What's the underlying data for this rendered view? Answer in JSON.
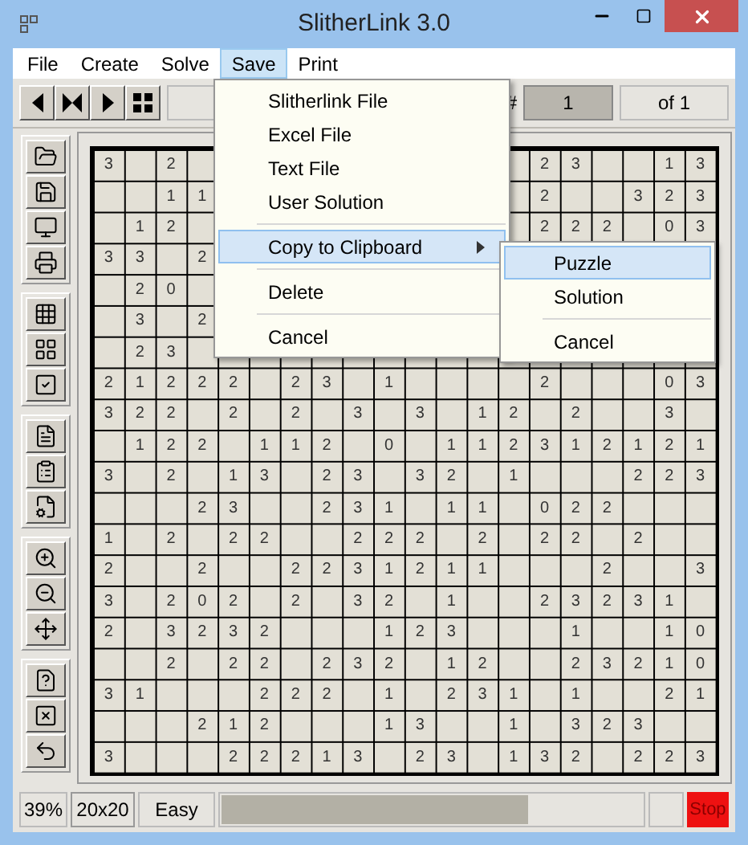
{
  "window": {
    "title": "SlitherLink 3.0"
  },
  "menu_bar": [
    {
      "label": "File",
      "selected": false
    },
    {
      "label": "Create",
      "selected": false
    },
    {
      "label": "Solve",
      "selected": false
    },
    {
      "label": "Save",
      "selected": true
    },
    {
      "label": "Print",
      "selected": false
    }
  ],
  "toolbar": {
    "puzzle_number_label": "#",
    "puzzle_number": "1",
    "puzzle_count": "of 1"
  },
  "grid": {
    "rows": [
      [
        "3",
        "",
        "2",
        "",
        "",
        "",
        "",
        "",
        "",
        "",
        "",
        "",
        "",
        "",
        "2",
        "3",
        "",
        "",
        "1",
        "3"
      ],
      [
        "",
        "",
        "1",
        "1",
        "",
        "",
        "",
        "",
        "",
        "",
        "",
        "",
        "",
        "",
        "2",
        "",
        "",
        "3",
        "2",
        "3"
      ],
      [
        "",
        "1",
        "2",
        "",
        "",
        "",
        "",
        "",
        "",
        "",
        "",
        "",
        "",
        "",
        "2",
        "2",
        "2",
        "",
        "0",
        "3"
      ],
      [
        "3",
        "3",
        "",
        "2",
        "",
        "",
        "",
        "",
        "",
        "",
        "",
        "",
        "",
        "",
        "",
        "",
        "",
        "",
        "",
        ""
      ],
      [
        "",
        "2",
        "0",
        "",
        "",
        "",
        "",
        "",
        "",
        "",
        "",
        "",
        "",
        "",
        "",
        "",
        "",
        "",
        "",
        ""
      ],
      [
        "",
        "3",
        "",
        "2",
        "",
        "",
        "",
        "",
        "",
        "",
        "",
        "",
        "",
        "",
        "",
        "",
        "",
        "",
        "",
        ""
      ],
      [
        "",
        "2",
        "3",
        "",
        "",
        "",
        "",
        "",
        "",
        "",
        "",
        "",
        "",
        "",
        "",
        "",
        "",
        "",
        "",
        ""
      ],
      [
        "2",
        "1",
        "2",
        "2",
        "2",
        "",
        "2",
        "3",
        "",
        "1",
        "",
        "",
        "",
        "",
        "2",
        "",
        "",
        "",
        "0",
        "3"
      ],
      [
        "3",
        "2",
        "2",
        "",
        "2",
        "",
        "2",
        "",
        "3",
        "",
        "3",
        "",
        "1",
        "2",
        "",
        "2",
        "",
        "",
        "3",
        ""
      ],
      [
        "",
        "1",
        "2",
        "2",
        "",
        "1",
        "1",
        "2",
        "",
        "0",
        "",
        "1",
        "1",
        "2",
        "3",
        "1",
        "2",
        "1",
        "2",
        "1"
      ],
      [
        "3",
        "",
        "2",
        "",
        "1",
        "3",
        "",
        "2",
        "3",
        "",
        "3",
        "2",
        "",
        "1",
        "",
        "",
        "",
        "2",
        "2",
        "3"
      ],
      [
        "",
        "",
        "",
        "2",
        "3",
        "",
        "",
        "2",
        "3",
        "1",
        "",
        "1",
        "1",
        "",
        "0",
        "2",
        "2",
        "",
        "",
        ""
      ],
      [
        "1",
        "",
        "2",
        "",
        "2",
        "2",
        "",
        "",
        "2",
        "2",
        "2",
        "",
        "2",
        "",
        "2",
        "2",
        "",
        "2",
        "",
        ""
      ],
      [
        "2",
        "",
        "",
        "2",
        "",
        "",
        "2",
        "2",
        "3",
        "1",
        "2",
        "1",
        "1",
        "",
        "",
        "",
        "2",
        "",
        "",
        "3"
      ],
      [
        "3",
        "",
        "2",
        "0",
        "2",
        "",
        "2",
        "",
        "3",
        "2",
        "",
        "1",
        "",
        "",
        "2",
        "3",
        "2",
        "3",
        "1",
        ""
      ],
      [
        "2",
        "",
        "3",
        "2",
        "3",
        "2",
        "",
        "",
        "",
        "1",
        "2",
        "3",
        "",
        "",
        "",
        "1",
        "",
        "",
        "1",
        "0"
      ],
      [
        "",
        "",
        "2",
        "",
        "2",
        "2",
        "",
        "2",
        "3",
        "2",
        "",
        "1",
        "2",
        "",
        "",
        "2",
        "3",
        "2",
        "1",
        "0"
      ],
      [
        "3",
        "1",
        "",
        "",
        "",
        "2",
        "2",
        "2",
        "",
        "1",
        "",
        "2",
        "3",
        "1",
        "",
        "1",
        "",
        "",
        "2",
        "1"
      ],
      [
        "",
        "",
        "",
        "2",
        "1",
        "2",
        "",
        "",
        "",
        "1",
        "3",
        "",
        "",
        "1",
        "",
        "3",
        "2",
        "3",
        "",
        ""
      ],
      [
        "3",
        "",
        "",
        "",
        "2",
        "2",
        "2",
        "1",
        "3",
        "",
        "2",
        "3",
        "",
        "1",
        "3",
        "2",
        "",
        "2",
        "2",
        "3"
      ]
    ]
  },
  "save_menu": {
    "items": [
      {
        "kind": "item",
        "label": "Slitherlink File",
        "selected": false
      },
      {
        "kind": "item",
        "label": "Excel File",
        "selected": false
      },
      {
        "kind": "item",
        "label": "Text File",
        "selected": false
      },
      {
        "kind": "item",
        "label": "User Solution",
        "selected": false
      },
      {
        "kind": "separator"
      },
      {
        "kind": "submenu",
        "label": "Copy to Clipboard",
        "selected": true
      },
      {
        "kind": "separator"
      },
      {
        "kind": "item",
        "label": "Delete",
        "selected": false
      },
      {
        "kind": "separator"
      },
      {
        "kind": "item",
        "label": "Cancel",
        "selected": false
      }
    ]
  },
  "clipboard_submenu": {
    "items": [
      {
        "kind": "item",
        "label": "Puzzle",
        "selected": true
      },
      {
        "kind": "item",
        "label": "Solution",
        "selected": false
      },
      {
        "kind": "separator"
      },
      {
        "kind": "item",
        "label": "Cancel",
        "selected": false
      }
    ]
  },
  "status_bar": {
    "percent": "39%",
    "size": "20x20",
    "difficulty": "Easy",
    "progress": {
      "level": 0.73
    },
    "stop_button": "Stop"
  }
}
